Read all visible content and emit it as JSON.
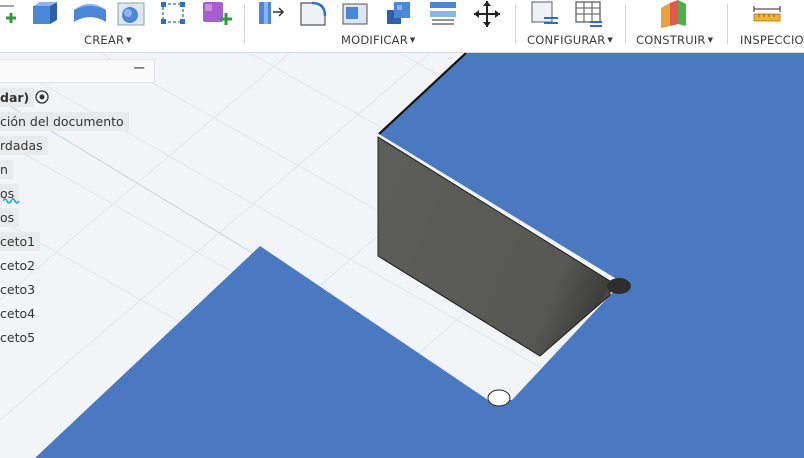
{
  "toolbar": {
    "groups": [
      {
        "label": "CREAR"
      },
      {
        "label": "MODIFICAR"
      },
      {
        "label": "CONFIGURAR"
      },
      {
        "label": "CONSTRUIR"
      },
      {
        "label": "INSPECCION"
      }
    ]
  },
  "browser": {
    "items": [
      {
        "label": "dar)"
      },
      {
        "label": "ción del documento"
      },
      {
        "label": "rdadas"
      },
      {
        "label": "n"
      },
      {
        "label": "os"
      },
      {
        "label": "os"
      },
      {
        "label": "ceto1"
      },
      {
        "label": "ceto2"
      },
      {
        "label": "ceto3"
      },
      {
        "label": "ceto4"
      },
      {
        "label": "ceto5"
      }
    ]
  },
  "colors": {
    "sketch_profile": "#4a79c2",
    "extruded_face": "#5a5a56",
    "canvas": "#f2f5f8"
  }
}
